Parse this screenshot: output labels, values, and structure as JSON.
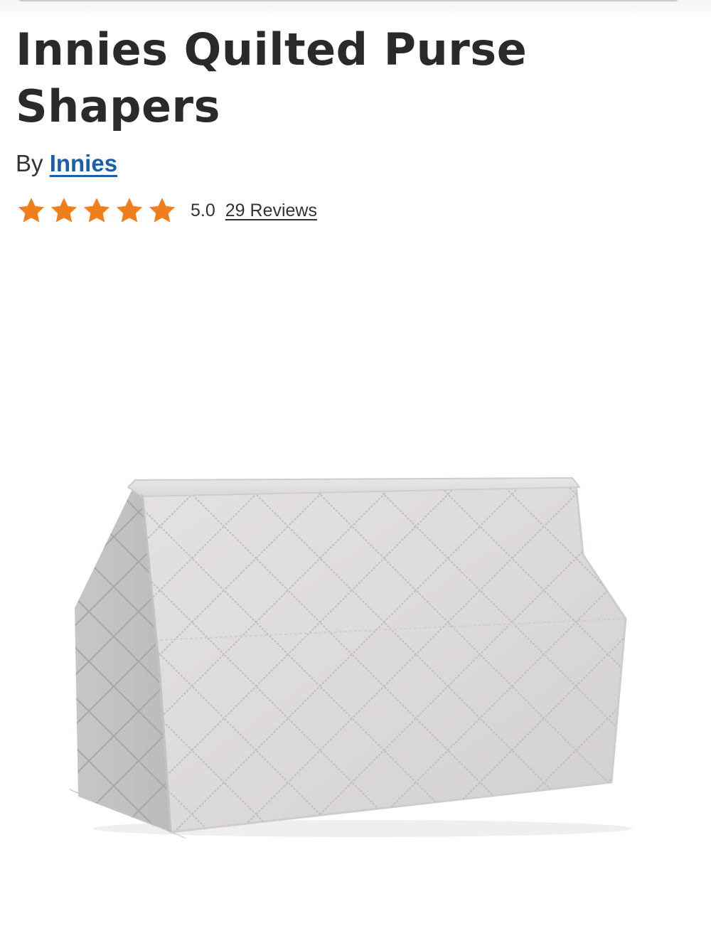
{
  "product": {
    "title": "Innies Quilted Purse Shapers",
    "by_prefix": "By",
    "brand": "Innies",
    "rating": {
      "stars": 5,
      "value": "5.0",
      "reviews_label": "29 Reviews",
      "star_color": "#ef7f1a"
    },
    "image": {
      "icon": "quilted-purse-shaper-photo"
    }
  },
  "colors": {
    "title": "#2a2a2a",
    "link": "#1a5fa8",
    "accent": "#ef7f1a"
  }
}
